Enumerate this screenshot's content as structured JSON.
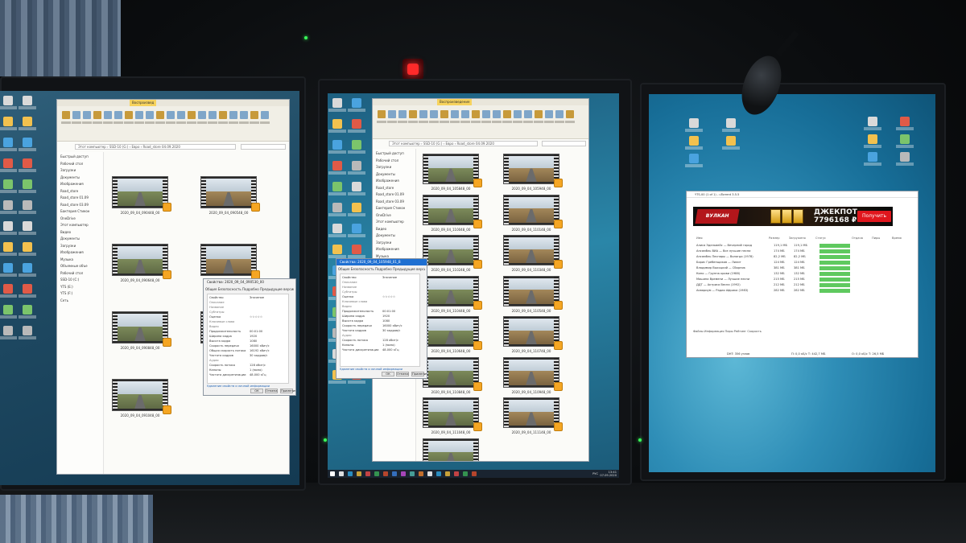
{
  "colors": {
    "wallpaper_left": "#1f4a63",
    "wallpaper_center": "#2a86a8",
    "wallpaper_right": "#2f8eb7",
    "explorer_tab": "#f7d35d",
    "progress": "#5fc95f",
    "banner_red": "#e0161d",
    "power_led": "#39ff5a",
    "indicator_red": "#ff2a2a"
  },
  "left_monitor": {
    "tab_label": "Воспроизвед",
    "address": "Этот компьютер › SSD-10 (G:) › Евро › Road_store 04.09.2020",
    "nav": [
      "Быстрый доступ",
      "Рабочий стол",
      "Загрузки",
      "Документы",
      "Изображения",
      "Road_store",
      "Road_store 01.09",
      "Road_store 03.09",
      "Бактерия Стикон",
      "OneDrive",
      "Этот компьютер",
      "Видео",
      "Документы",
      "Загрузки",
      "Изображения",
      "Музыка",
      "Объемные объе",
      "Рабочий стол",
      "SSD-10 (C:)",
      "YTS (E:)",
      "YTS (F:)",
      "Сеть"
    ],
    "thumbs": [
      "2020_09_04_090448_00",
      "2020_09_04_090548_00",
      "2020_09_04_090648_00",
      "2020_09_04_090748_00",
      "2020_09_04_090848_00",
      "2020_09_04_090948_00",
      "2020_09_04_091048_00"
    ],
    "dialog": {
      "title": "Свойства: 2020_09_04_090530_00",
      "tabs": "Общие  Безопасность  Подробно  Предыдущие версии",
      "rows": [
        {
          "k": "Свойство",
          "v": "Значение"
        },
        {
          "k": "Описание",
          "v": ""
        },
        {
          "k": "Название",
          "v": ""
        },
        {
          "k": "Субтитры",
          "v": ""
        },
        {
          "k": "Оценка",
          "v": "☆☆☆☆☆"
        },
        {
          "k": "Ключевые слова",
          "v": ""
        },
        {
          "k": "Видео",
          "v": ""
        },
        {
          "k": "Продолжительность",
          "v": "00:01:00"
        },
        {
          "k": "Ширина кадра",
          "v": "1920"
        },
        {
          "k": "Высота кадра",
          "v": "1080"
        },
        {
          "k": "Скорость передачи",
          "v": "16000 кбит/с"
        },
        {
          "k": "Общая скорость потока",
          "v": "16192 кбит/с"
        },
        {
          "k": "Частота кадров",
          "v": "30 кадров/с"
        },
        {
          "k": "Аудио",
          "v": ""
        },
        {
          "k": "Скорость потока",
          "v": "128 кбит/с"
        },
        {
          "k": "Каналы",
          "v": "1 (моно)"
        },
        {
          "k": "Частота дискретизации",
          "v": "48.000 кГц"
        }
      ],
      "remove_link": "Удаление свойств и личной информации",
      "ok": "ОК",
      "cancel": "Отмена",
      "apply": "Применить"
    }
  },
  "center_monitor": {
    "tab_label": "Воспроизведение",
    "address": "Этот компьютер › SSD-10 (G:) › Евро › Road_store 04.09.2020",
    "nav": [
      "Быстрый доступ",
      "Рабочий стол",
      "Загрузки",
      "Документы",
      "Изображения",
      "Road_store",
      "Road_store 01.09",
      "Road_store 03.09",
      "Бактерия Стикон",
      "OneDrive",
      "Этот компьютер",
      "Видео",
      "Документы",
      "Загрузки",
      "Изображения",
      "Музыка",
      "Объемные объе"
    ],
    "thumbs": [
      "2020_09_04_105848_00",
      "2020_09_04_105948_00",
      "2020_09_04_110048_00",
      "2020_09_04_110148_00",
      "2020_09_04_110248_00",
      "2020_09_04_110348_00",
      "2020_09_04_110448_00",
      "2020_09_04_110548_00",
      "2020_09_04_110648_00",
      "2020_09_04_110748_00",
      "2020_09_04_110848_00",
      "2020_09_04_110948_00",
      "2020_09_04_111048_00",
      "2020_09_04_111148_00",
      "2020_09_04_111248_00"
    ],
    "dialog": {
      "title": "Свойства: 2020_09_04_105948_01_B",
      "tabs": "Общие  Безопасность  Подробно  Предыдущие версии",
      "rows": [
        {
          "k": "Свойство",
          "v": "Значение"
        },
        {
          "k": "Описание",
          "v": ""
        },
        {
          "k": "Название",
          "v": ""
        },
        {
          "k": "Субтитры",
          "v": ""
        },
        {
          "k": "Оценка",
          "v": "☆☆☆☆☆"
        },
        {
          "k": "Ключевые слова",
          "v": ""
        },
        {
          "k": "Видео",
          "v": ""
        },
        {
          "k": "Продолжительность",
          "v": "00:01:00"
        },
        {
          "k": "Ширина кадра",
          "v": "1920"
        },
        {
          "k": "Высота кадра",
          "v": "1080"
        },
        {
          "k": "Скорость передачи",
          "v": "16000 кбит/с"
        },
        {
          "k": "Частота кадров",
          "v": "30 кадров/с"
        },
        {
          "k": "Аудио",
          "v": ""
        },
        {
          "k": "Скорость потока",
          "v": "128 кбит/с"
        },
        {
          "k": "Каналы",
          "v": "1 (моно)"
        },
        {
          "k": "Частота дискретизации",
          "v": "48.000 кГц"
        }
      ],
      "remove_link": "Удаление свойств и личной информации",
      "ok": "ОК",
      "cancel": "Отмена",
      "apply": "Применить"
    },
    "taskbar_time": "13:41",
    "taskbar_date": "07.09.2020",
    "taskbar_lang": "РУС"
  },
  "right_monitor": {
    "torrent_title": "YTS-00 (1 of 1) - uTorrent 3.5.5",
    "banner": {
      "logo": "ВУЛКАН",
      "jackpot": "ДЖЕКПОТ",
      "jackpot_amount": "7796168 ₽",
      "button": "Получить"
    },
    "columns": [
      "Имя",
      "Размер",
      "Загружено",
      "Статус",
      "Отдача",
      "Пиры",
      "Время"
    ],
    "rows": [
      {
        "name": "Алиса Эдельвейс — Вечерний город",
        "size": "119,1 МБ",
        "done": "119,1 МБ",
        "progress": 1.0
      },
      {
        "name": "Ансамбль ВИА — Все лучшие песни",
        "size": "174 МБ",
        "done": "174 МБ",
        "progress": 1.0
      },
      {
        "name": "Ансамбль Песняры — Вологда (1978)",
        "size": "82,2 МБ",
        "done": "82,2 МБ",
        "progress": 1.0
      },
      {
        "name": "Борис Гребенщиков — Лилит",
        "size": "124 МБ",
        "done": "124 МБ",
        "progress": 1.0
      },
      {
        "name": "Владимир Высоцкий — Сборник",
        "size": "381 МБ",
        "done": "381 МБ",
        "progress": 1.0
      },
      {
        "name": "Кино — Группа крови (1988)",
        "size": "132 МБ",
        "done": "132 МБ",
        "progress": 1.0
      },
      {
        "name": "Машина Времени — Лучшие песни",
        "size": "215 МБ",
        "done": "215 МБ",
        "progress": 1.0
      },
      {
        "name": "ДДТ — Актриса Весна (1992)",
        "size": "212 МБ",
        "done": "212 МБ",
        "progress": 1.0
      },
      {
        "name": "Аквариум — Радио Африка (1983)",
        "size": "282 МБ",
        "done": "282 МБ",
        "progress": 1.0
      }
    ],
    "bottom_tabs": "Файлы  Информация  Пиры  Рейтинг  Скорость",
    "status_left": "DHT: 356 узлов",
    "status_mid": "П: 0,0 кБ/с  Т: 442,7 МБ",
    "status_right": "О: 0,0 кБ/с  Т: 26,5 МБ"
  }
}
